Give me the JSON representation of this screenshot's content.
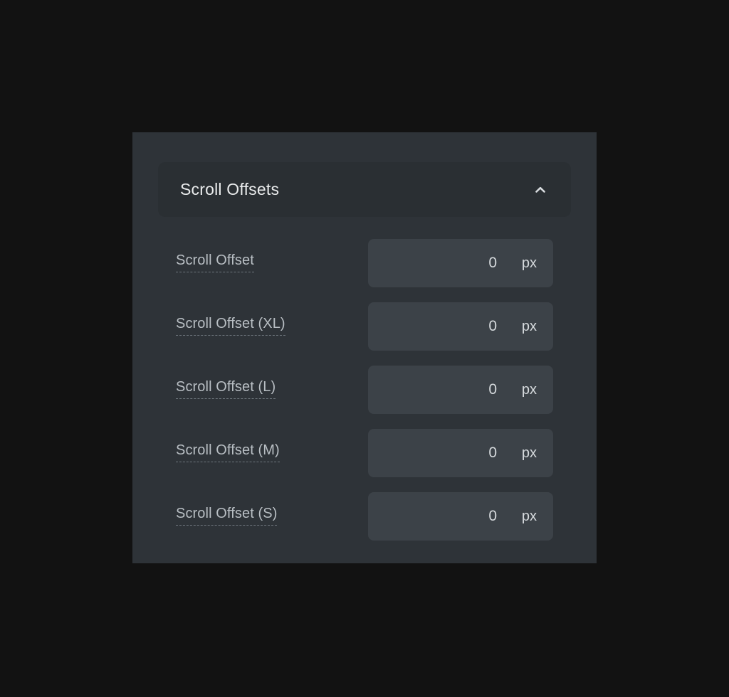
{
  "theme": {
    "page_background": "#121212",
    "panel_background": "#2e3338",
    "header_background": "#2a2f33",
    "field_background": "#3c4248",
    "title_color": "#e9ebec",
    "label_color": "#b9bfc4",
    "value_color": "#d6dadd"
  },
  "panel": {
    "header": {
      "title": "Scroll Offsets",
      "collapse_icon": "chevron-up-icon",
      "expanded": true
    },
    "rows": [
      {
        "label": "Scroll Offset",
        "value": "0",
        "unit": "px"
      },
      {
        "label": "Scroll Offset (XL)",
        "value": "0",
        "unit": "px"
      },
      {
        "label": "Scroll Offset (L)",
        "value": "0",
        "unit": "px"
      },
      {
        "label": "Scroll Offset (M)",
        "value": "0",
        "unit": "px"
      },
      {
        "label": "Scroll Offset (S)",
        "value": "0",
        "unit": "px"
      }
    ]
  }
}
